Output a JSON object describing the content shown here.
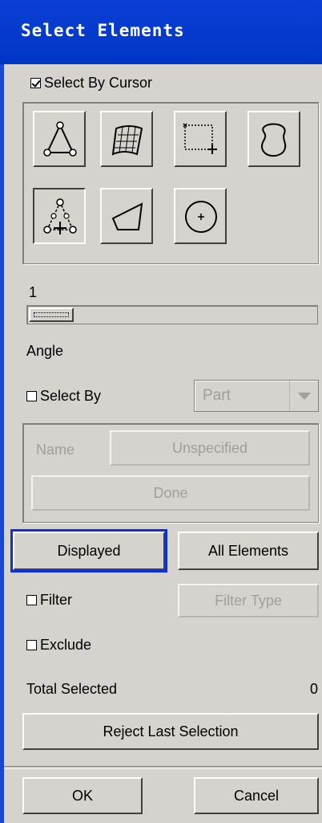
{
  "window": {
    "title": "Select Elements"
  },
  "select_by_cursor": {
    "label": "Select By Cursor",
    "checked": true
  },
  "tools": [
    {
      "name": "tool-triangle-nodes",
      "icon": "triangle-nodes-icon"
    },
    {
      "name": "tool-surface-mesh",
      "icon": "mesh-surface-icon"
    },
    {
      "name": "tool-rectangle-select",
      "icon": "rectangle-select-icon"
    },
    {
      "name": "tool-freeform-select",
      "icon": "freeform-select-icon"
    },
    {
      "name": "tool-adjacent-nodes",
      "icon": "adjacent-nodes-icon",
      "pressed": true
    },
    {
      "name": "tool-polygon-select",
      "icon": "polygon-select-icon"
    },
    {
      "name": "tool-circle-select",
      "icon": "circle-select-icon"
    }
  ],
  "slider": {
    "value": "1"
  },
  "angle_label": "Angle",
  "select_by": {
    "label": "Select By",
    "checked": false,
    "dropdown_value": "Part"
  },
  "name_row": {
    "label": "Name",
    "value_button": "Unspecified",
    "done_button": "Done"
  },
  "buttons": {
    "displayed": "Displayed",
    "all_elements": "All Elements",
    "filter_type": "Filter Type",
    "reject_last": "Reject Last Selection",
    "ok": "OK",
    "cancel": "Cancel"
  },
  "filter": {
    "label": "Filter",
    "checked": false
  },
  "exclude": {
    "label": "Exclude",
    "checked": false
  },
  "total_selected": {
    "label": "Total Selected",
    "count": "0"
  },
  "colors": {
    "titlebar": "#0036c4",
    "highlight": "#0a2ee6",
    "background": "#d6d3ce"
  }
}
